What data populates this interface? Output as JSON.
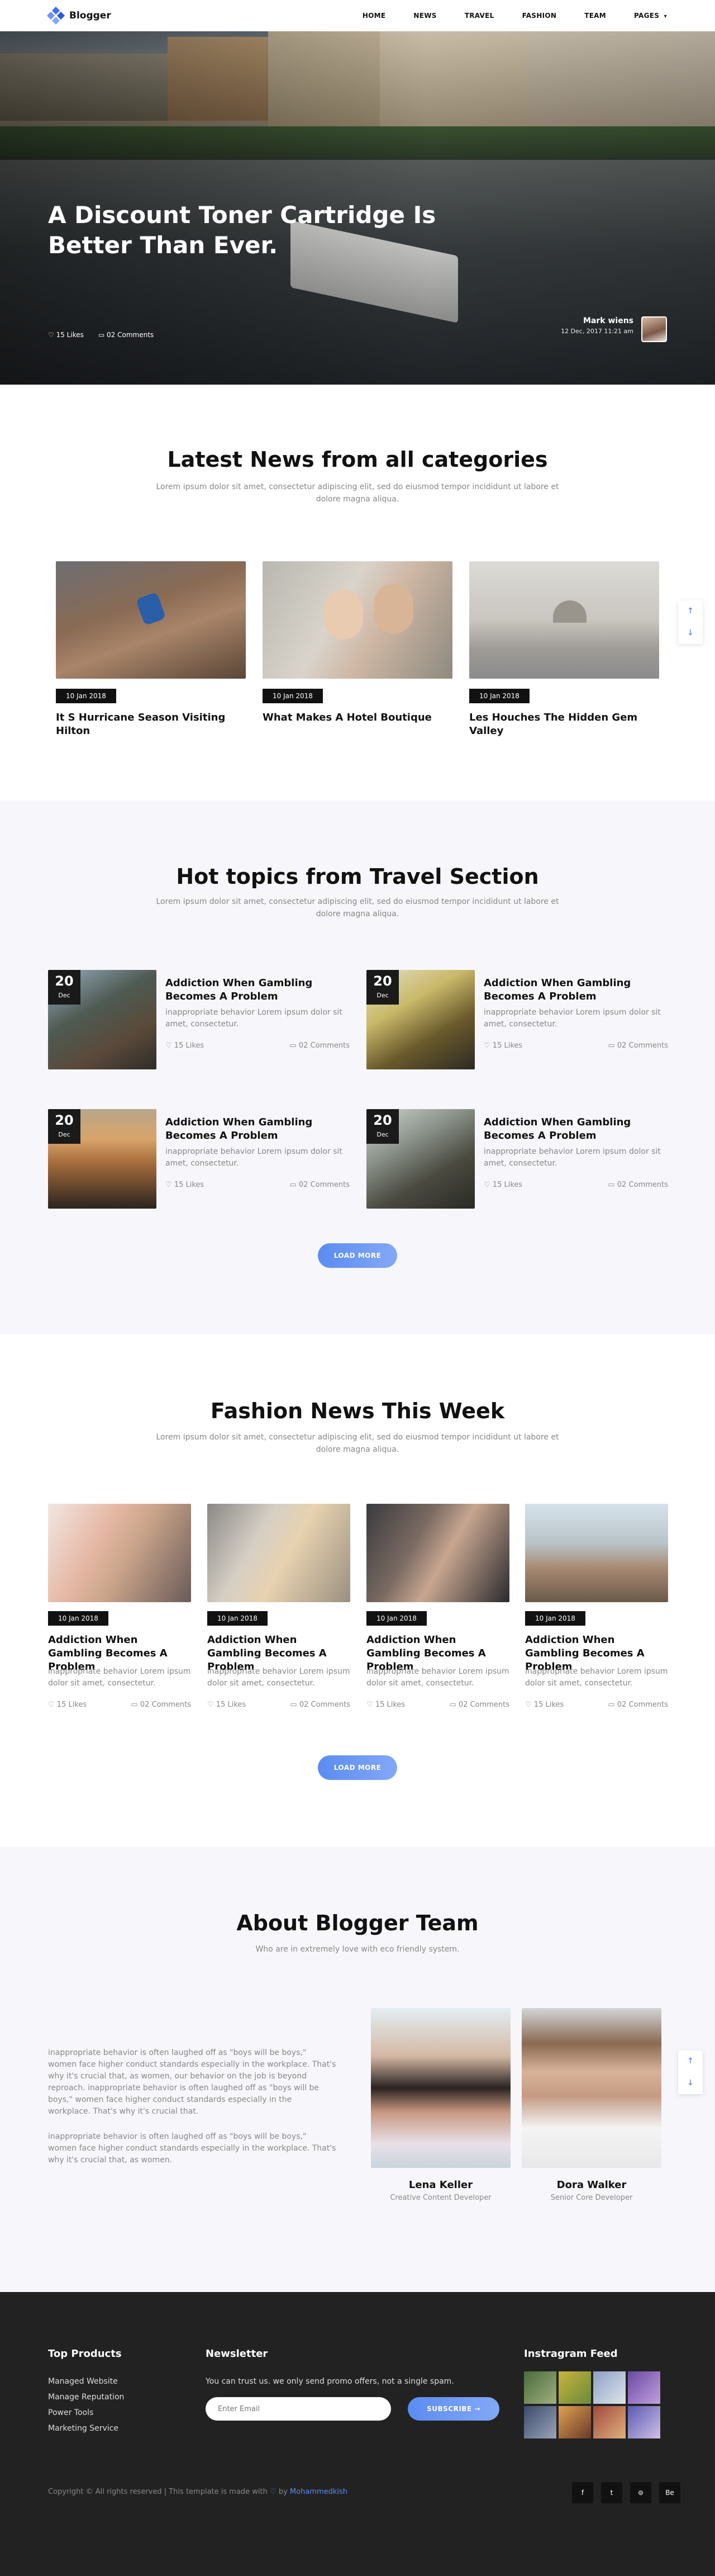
{
  "nav": {
    "brand": "Blogger",
    "items": [
      "HOME",
      "NEWS",
      "TRAVEL",
      "FASHION",
      "TEAM",
      "PAGES"
    ],
    "pages_caret": "▾"
  },
  "hero": {
    "title": "A Discount Toner Cartridge Is Better Than Ever.",
    "likes": "15 Likes",
    "comments": "02 Comments",
    "author_name": "Mark wiens",
    "author_date": "12 Dec, 2017 11:21 am"
  },
  "latest": {
    "title": "Latest News from all categories",
    "subtitle": "Lorem ipsum dolor sit amet, consectetur adipiscing elit, sed do eiusmod tempor incididunt ut labore et dolore magna aliqua.",
    "cards": [
      {
        "date": "10 Jan 2018",
        "title": "It S Hurricane Season Visiting Hilton"
      },
      {
        "date": "10 Jan 2018",
        "title": "What Makes A Hotel Boutique"
      },
      {
        "date": "10 Jan 2018",
        "title": "Les Houches The Hidden Gem Valley"
      }
    ],
    "arrow_up": "↑",
    "arrow_down": "↓"
  },
  "hot": {
    "title": "Hot topics from Travel Section",
    "subtitle": "Lorem ipsum dolor sit amet, consectetur adipiscing elit, sed do eiusmod tempor incididunt ut labore et dolore magna aliqua.",
    "items": [
      {
        "day": "20",
        "month": "Dec",
        "title": "Addiction When Gambling Becomes A Problem",
        "desc": "inappropriate behavior Lorem ipsum dolor sit amet, consectetur.",
        "likes": "15 Likes",
        "comments": "02 Comments"
      },
      {
        "day": "20",
        "month": "Dec",
        "title": "Addiction When Gambling Becomes A Problem",
        "desc": "inappropriate behavior Lorem ipsum dolor sit amet, consectetur.",
        "likes": "15 Likes",
        "comments": "02 Comments"
      },
      {
        "day": "20",
        "month": "Dec",
        "title": "Addiction When Gambling Becomes A Problem",
        "desc": "inappropriate behavior Lorem ipsum dolor sit amet, consectetur.",
        "likes": "15 Likes",
        "comments": "02 Comments"
      },
      {
        "day": "20",
        "month": "Dec",
        "title": "Addiction When Gambling Becomes A Problem",
        "desc": "inappropriate behavior Lorem ipsum dolor sit amet, consectetur.",
        "likes": "15 Likes",
        "comments": "02 Comments"
      }
    ],
    "load_more": "LOAD MORE"
  },
  "fashion": {
    "title": "Fashion News This Week",
    "subtitle": "Lorem ipsum dolor sit amet, consectetur adipiscing elit, sed do eiusmod tempor incididunt ut labore et dolore magna aliqua.",
    "cards": [
      {
        "date": "10 Jan 2018",
        "title": "Addiction When Gambling Becomes A Problem",
        "desc": "inappropriate behavior Lorem ipsum dolor sit amet, consectetur.",
        "likes": "15 Likes",
        "comments": "02 Comments"
      },
      {
        "date": "10 Jan 2018",
        "title": "Addiction When Gambling Becomes A Problem",
        "desc": "inappropriate behavior Lorem ipsum dolor sit amet, consectetur.",
        "likes": "15 Likes",
        "comments": "02 Comments"
      },
      {
        "date": "10 Jan 2018",
        "title": "Addiction When Gambling Becomes A Problem",
        "desc": "inappropriate behavior Lorem ipsum dolor sit amet, consectetur.",
        "likes": "15 Likes",
        "comments": "02 Comments"
      },
      {
        "date": "10 Jan 2018",
        "title": "Addiction When Gambling Becomes A Problem",
        "desc": "inappropriate behavior Lorem ipsum dolor sit amet, consectetur.",
        "likes": "15 Likes",
        "comments": "02 Comments"
      }
    ],
    "load_more": "LOAD MORE"
  },
  "about": {
    "title": "About Blogger Team",
    "subtitle": "Who are in extremely love with eco friendly system.",
    "para1": "inappropriate behavior is often laughed off as \"boys will be boys,\" women face higher conduct standards especially in the workplace. That's why it's crucial that, as women, our behavior on the job is beyond reproach. inappropriate behavior is often laughed off as \"boys will be boys,\" women face higher conduct standards especially in the workplace. That's why it's crucial that.",
    "para2": "inappropriate behavior is often laughed off as \"boys will be boys,\" women face higher conduct standards especially in the workplace. That's why it's crucial that, as women.",
    "members": [
      {
        "name": "Lena Keller",
        "role": "Creative Content Developer"
      },
      {
        "name": "Dora Walker",
        "role": "Senior Core Developer"
      }
    ]
  },
  "footer": {
    "products_title": "Top Products",
    "products": [
      "Managed Website",
      "Manage Reputation",
      "Power Tools",
      "Marketing Service"
    ],
    "newsletter_title": "Newsletter",
    "newsletter_text": "You can trust us. we only send promo offers, not a single spam.",
    "email_placeholder": "Enter Email",
    "subscribe": "SUBSCRIBE",
    "instagram_title": "Instragram Feed",
    "copyright_pre": "Copyright © All rights reserved | This template is made with",
    "copyright_by": "by",
    "copyright_author": "Mohammedkish",
    "social": [
      "f",
      "t",
      "⊚",
      "Be"
    ]
  },
  "colors": {
    "accent": "#3f6ff0",
    "dark": "#222222",
    "footer_bg": "#222222"
  }
}
